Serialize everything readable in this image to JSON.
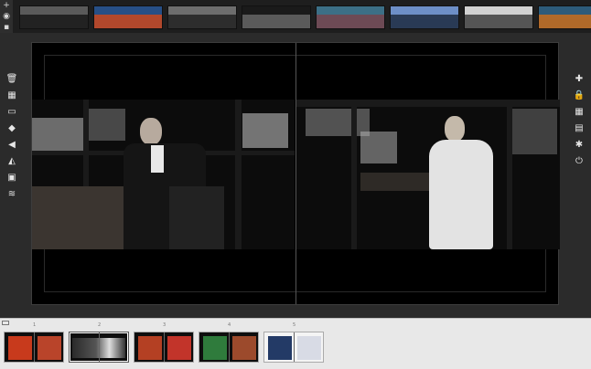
{
  "top_strip": {
    "controls": [
      "plus-icon",
      "eye-icon",
      "trash-icon"
    ],
    "photos": [
      {
        "name": "strip-photo-1",
        "colors": [
          "#5a5a5a",
          "#222222"
        ]
      },
      {
        "name": "strip-photo-2",
        "colors": [
          "#274f86",
          "#b2482c"
        ]
      },
      {
        "name": "strip-photo-3",
        "colors": [
          "#6d6d6d",
          "#2d2d2d"
        ]
      },
      {
        "name": "strip-photo-4",
        "colors": [
          "#1a1a1a",
          "#5a5a5a"
        ]
      },
      {
        "name": "strip-photo-5",
        "colors": [
          "#3c6f86",
          "#6d4a55"
        ]
      },
      {
        "name": "strip-photo-6",
        "colors": [
          "#6d8fc7",
          "#2a3b55"
        ]
      },
      {
        "name": "strip-photo-7",
        "colors": [
          "#d2d2d2",
          "#555555"
        ]
      },
      {
        "name": "strip-photo-8",
        "colors": [
          "#2d5b7a",
          "#b06a2a"
        ]
      }
    ]
  },
  "left_tools": [
    {
      "name": "delete-icon",
      "glyph": "🗑"
    },
    {
      "name": "grid-layout-icon",
      "glyph": "▦"
    },
    {
      "name": "frame-icon",
      "glyph": "▭"
    },
    {
      "name": "paint-bucket-icon",
      "glyph": "◆"
    },
    {
      "name": "flip-horizontal-icon",
      "glyph": "◀"
    },
    {
      "name": "mirror-icon",
      "glyph": "◭"
    },
    {
      "name": "border-icon",
      "glyph": "▣"
    },
    {
      "name": "layers-icon",
      "glyph": "≋"
    }
  ],
  "right_tools": [
    {
      "name": "add-icon",
      "glyph": "✚"
    },
    {
      "name": "lock-icon",
      "glyph": "🔒"
    },
    {
      "name": "grid-icon",
      "glyph": "▦"
    },
    {
      "name": "archive-icon",
      "glyph": "▤"
    },
    {
      "name": "bug-icon",
      "glyph": "✱"
    },
    {
      "name": "power-icon",
      "glyph": "⏻"
    }
  ],
  "nav": {
    "prev_glyph": "‹",
    "next_glyph": "›"
  },
  "pages": [
    {
      "label": "1",
      "active": false,
      "layout": "two",
      "colors": [
        "#c83a1c",
        "#b9442a"
      ]
    },
    {
      "label": "2",
      "active": true,
      "layout": "full",
      "colors": [
        "#2a2a2a",
        "#dedede"
      ]
    },
    {
      "label": "3",
      "active": false,
      "layout": "two",
      "colors": [
        "#b44023",
        "#c2342a"
      ]
    },
    {
      "label": "4",
      "active": false,
      "layout": "two",
      "colors": [
        "#2f7b3c",
        "#9c4a2c"
      ]
    },
    {
      "label": "5",
      "active": false,
      "layout": "two-light",
      "colors": [
        "#233a66",
        "#d8dbe5"
      ]
    }
  ]
}
